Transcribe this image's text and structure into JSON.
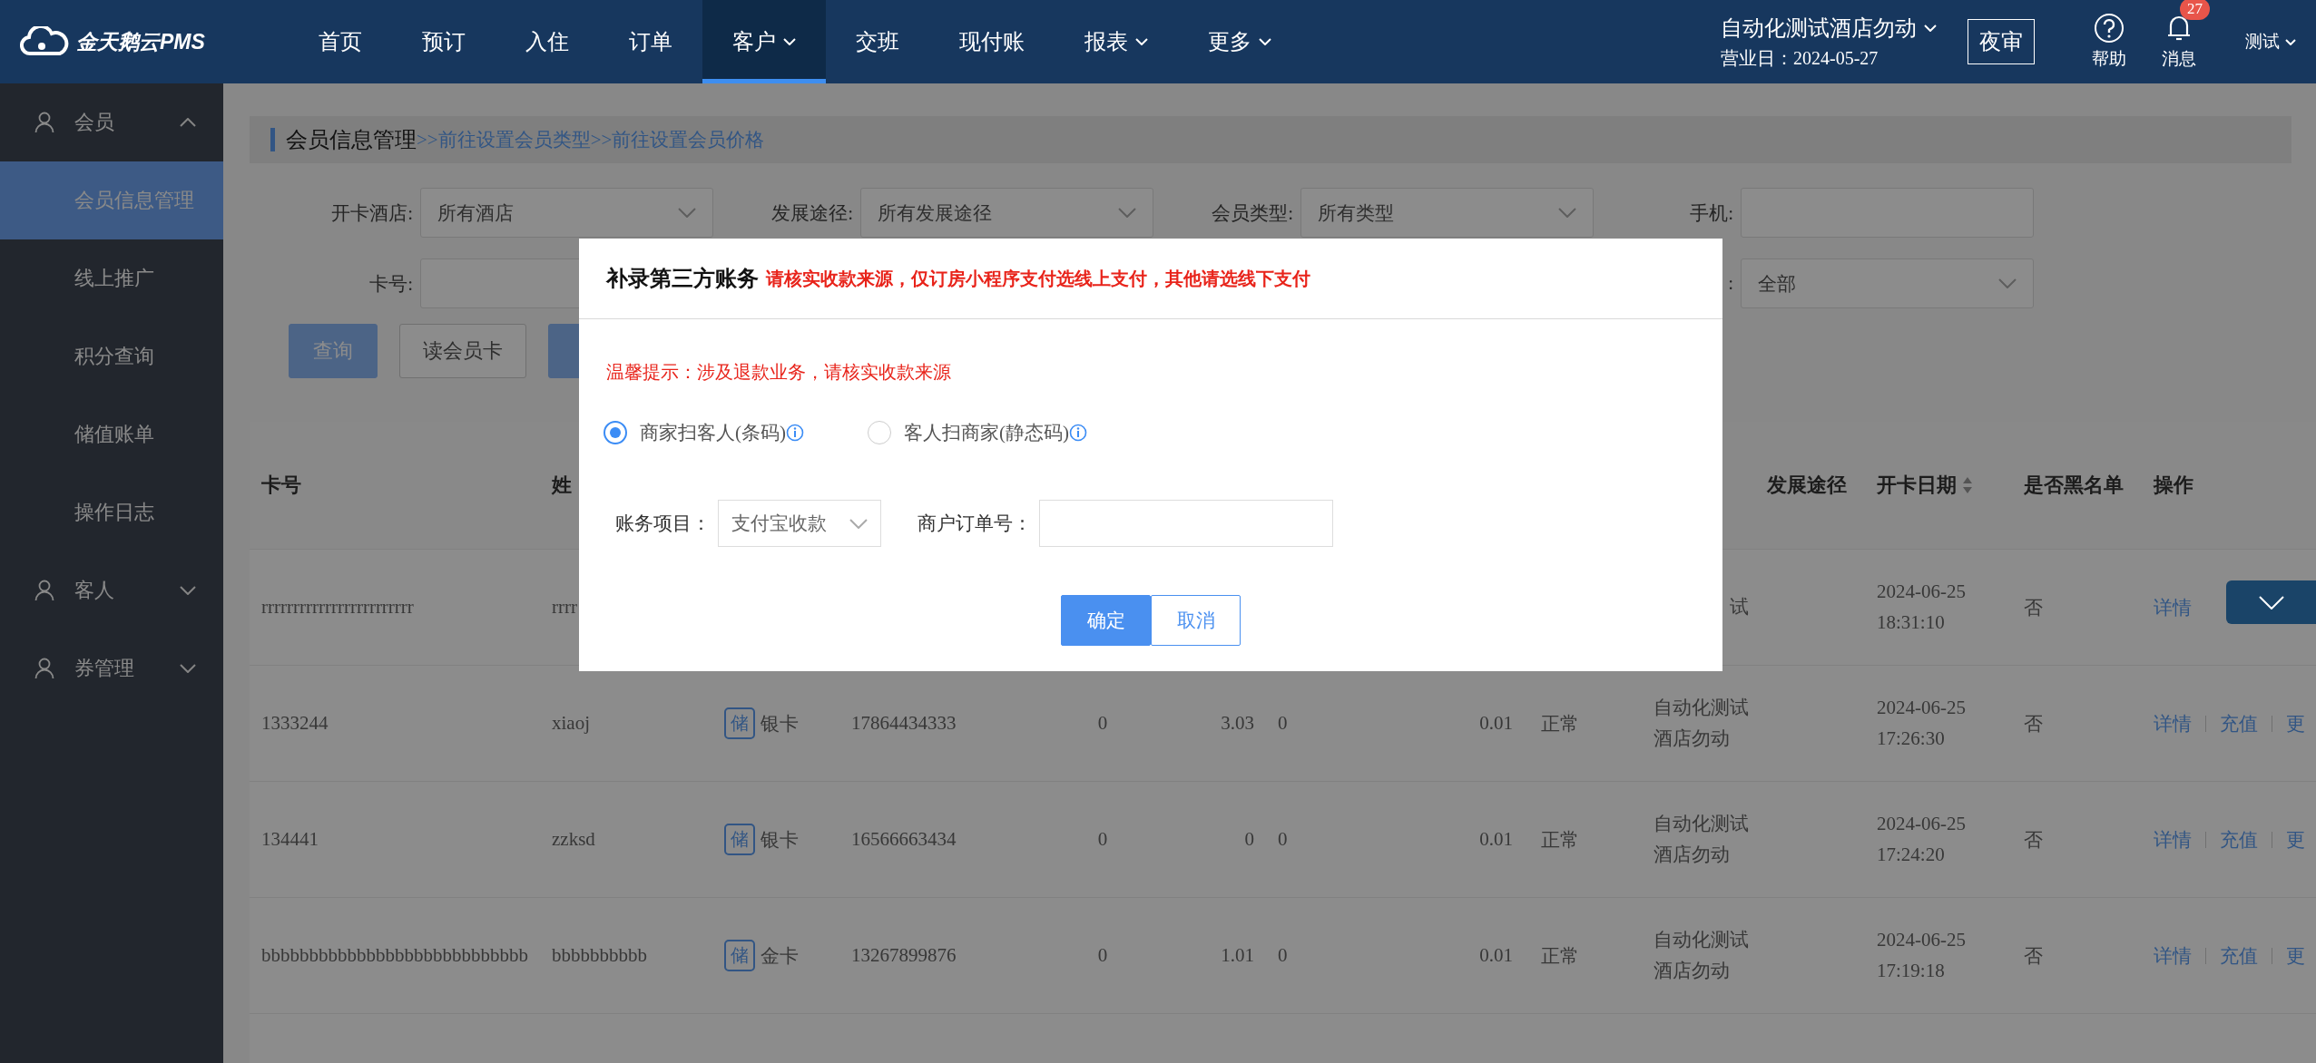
{
  "topbar": {
    "logo": "金天鹅云PMS",
    "nav": [
      {
        "label": "首页",
        "dropdown": false,
        "selected": false
      },
      {
        "label": "预订",
        "dropdown": false,
        "selected": false
      },
      {
        "label": "入住",
        "dropdown": false,
        "selected": false
      },
      {
        "label": "订单",
        "dropdown": false,
        "selected": false
      },
      {
        "label": "客户",
        "dropdown": true,
        "selected": true
      },
      {
        "label": "交班",
        "dropdown": false,
        "selected": false
      },
      {
        "label": "现付账",
        "dropdown": false,
        "selected": false
      },
      {
        "label": "报表",
        "dropdown": true,
        "selected": false
      },
      {
        "label": "更多",
        "dropdown": true,
        "selected": false
      }
    ],
    "hotel": {
      "name": "自动化测试酒店勿动",
      "business_day": "营业日：2024-05-27"
    },
    "night_audit": "夜审",
    "help": "帮助",
    "messages": {
      "label": "消息",
      "count": "27"
    },
    "user": "测试"
  },
  "sidebar": [
    {
      "label": "会员",
      "expanded": true,
      "children": [
        {
          "label": "会员信息管理",
          "selected": true
        },
        {
          "label": "线上推广",
          "selected": false
        },
        {
          "label": "积分查询",
          "selected": false
        },
        {
          "label": "储值账单",
          "selected": false
        },
        {
          "label": "操作日志",
          "selected": false
        }
      ]
    },
    {
      "label": "客人",
      "expanded": false
    },
    {
      "label": "券管理",
      "expanded": false
    }
  ],
  "page": {
    "title": "会员信息管理",
    "links": [
      ">>前往设置会员类型",
      ">>前往设置会员价格"
    ]
  },
  "filters": [
    [
      {
        "label": "开卡酒店:",
        "kind": "select",
        "value": "所有酒店"
      },
      {
        "label": "发展途径:",
        "kind": "select",
        "value": "所有发展途径"
      },
      {
        "label": "会员类型:",
        "kind": "select",
        "value": "所有类型"
      },
      {
        "label": "手机:",
        "kind": "input"
      }
    ],
    [
      {
        "label": "卡号:",
        "kind": "input"
      },
      {
        "label": ":",
        "kind": "select",
        "value": "全部"
      }
    ]
  ],
  "actions": [
    {
      "label": "查询",
      "kind": "primary"
    },
    {
      "label": "读会员卡",
      "kind": "default"
    },
    {
      "kind": "primary"
    }
  ],
  "table": {
    "headers": {
      "card_no": "卡号",
      "name": "姓",
      "dev_path": "发展途径",
      "open_date": "开卡日期",
      "blacklist": "是否黑名单",
      "actions": "操作"
    },
    "rows": [
      {
        "card_no": "rrrrrrrrrrrrrrrrrrrrrrrr",
        "name": "rrrr",
        "dev_path": [
          "试"
        ],
        "open_date": [
          "2024-06-25",
          "18:31:10"
        ],
        "blacklist": "否",
        "actions": [
          "详情"
        ]
      },
      {
        "card_no": "1333244",
        "name": "xiaoj",
        "badge": "储",
        "card_type": "银卡",
        "phone": "17864434333",
        "column_4": "0",
        "column_5": "3.03",
        "column_6": "0",
        "column_7": "0.01",
        "column_8": "正常",
        "dev_path": [
          "自动化测试",
          "酒店勿动"
        ],
        "open_date": [
          "2024-06-25",
          "17:26:30"
        ],
        "blacklist": "否",
        "actions": [
          "详情",
          "充值",
          "更"
        ]
      },
      {
        "card_no": "134441",
        "name": "zzksd",
        "badge": "储",
        "card_type": "银卡",
        "phone": "16566663434",
        "column_4": "0",
        "column_5": "0",
        "column_6": "0",
        "column_7": "0.01",
        "column_8": "正常",
        "dev_path": [
          "自动化测试",
          "酒店勿动"
        ],
        "open_date": [
          "2024-06-25",
          "17:24:20"
        ],
        "blacklist": "否",
        "actions": [
          "详情",
          "充值",
          "更"
        ]
      },
      {
        "card_no": "bbbbbbbbbbbbbbbbbbbbbbbbbbbb",
        "name": "bbbbbbbbbb",
        "badge": "储",
        "card_type": "金卡",
        "phone": "13267899876",
        "column_4": "0",
        "column_5": "1.01",
        "column_6": "0",
        "column_7": "0.01",
        "column_8": "正常",
        "dev_path": [
          "自动化测试",
          "酒店勿动"
        ],
        "open_date": [
          "2024-06-25",
          "17:19:18"
        ],
        "blacklist": "否",
        "actions": [
          "详情",
          "充值",
          "更"
        ]
      }
    ]
  },
  "modal": {
    "title": "补录第三方账务",
    "notice": "请核实收款来源，仅订房小程序支付选线上支付，其他请选线下支付",
    "warning": "温馨提示：涉及退款业务，请核实收款来源",
    "options": [
      {
        "label": "商家扫客人(条码)",
        "selected": true
      },
      {
        "label": "客人扫商家(静态码)",
        "selected": false
      }
    ],
    "fields": [
      {
        "label": "账务项目：",
        "kind": "select",
        "value": "支付宝收款"
      },
      {
        "label": "商户订单号：",
        "kind": "input"
      }
    ],
    "buttons": [
      {
        "label": "确定",
        "kind": "primary"
      },
      {
        "label": "取消",
        "kind": "default"
      }
    ]
  }
}
